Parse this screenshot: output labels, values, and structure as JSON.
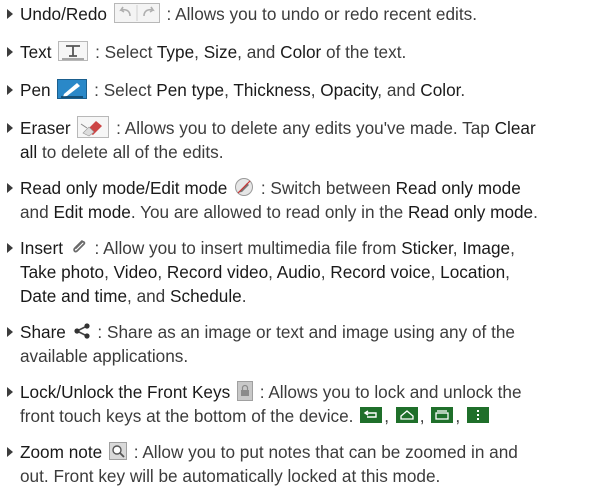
{
  "colors": {
    "text": "#3c3c3c",
    "bullet": "#3c3c3c",
    "pen_icon": "#2a88c8",
    "key_icon": "#1f6f2a"
  },
  "items": [
    {
      "title": "Undo/Redo",
      "icon": "undo-redo-icon",
      "after": " : Allows you to undo or redo recent edits."
    },
    {
      "title": "Text",
      "icon": "text-tool-icon",
      "p1": " : Select ",
      "t1": "Type",
      "p2": ", ",
      "t2": "Size",
      "p3": ", and ",
      "t3": "Color",
      "p4": " of the text."
    },
    {
      "title": "Pen",
      "icon": "pen-tool-icon",
      "p1": " : Select ",
      "t1": "Pen type",
      "p2": ", ",
      "t2": "Thickness",
      "p3": ", ",
      "t3": "Opacity",
      "p4": ", and ",
      "t4": "Color",
      "p5": "."
    },
    {
      "title": "Eraser",
      "icon": "eraser-icon",
      "line1": " : Allows you to delete any edits you've made. Tap ",
      "t1": "Clear",
      "t2": "all",
      "line2": " to delete all of the edits."
    },
    {
      "title": "Read only mode/Edit mode",
      "icon": "read-edit-mode-icon",
      "p1": " : Switch between ",
      "t1": "Read only mode",
      "p2": "and ",
      "t2": "Edit mode",
      "p3": ". You are allowed to read only in the ",
      "t3": "Read only mode",
      "p4": "."
    },
    {
      "title": "Insert",
      "icon": "paperclip-icon",
      "p1": " : Allow you to insert multimedia file from ",
      "t1": "Sticker",
      "p2": ", ",
      "t2": "Image",
      "p3": ",",
      "t3": "Take photo",
      "p4": ", ",
      "t4": "Video",
      "p5": ", ",
      "t5": "Record video",
      "p6": ", ",
      "t6": "Audio",
      "p7": ", ",
      "t7": "Record voice",
      "p8": ", ",
      "t8": "Location",
      "p9": ",",
      "t9": "Date and time",
      "p10": ", and ",
      "t10": "Schedule",
      "p11": "."
    },
    {
      "title": "Share",
      "icon": "share-icon",
      "line1": " : Share as an image or text and image using any of the",
      "line2": "available applications."
    },
    {
      "title": "Lock/Unlock the Front Keys",
      "icon": "lock-keys-icon",
      "line1": " : Allows you to lock and unlock the",
      "line2": "front touch keys at the bottom of the device.",
      "sep1": ",",
      "sep2": ",",
      "sep3": ","
    },
    {
      "title": "Zoom note",
      "icon": "zoom-note-icon",
      "line1": " : Allow you to put notes that can be zoomed in and",
      "line2": "out. Front key will be automatically locked at this mode."
    }
  ]
}
